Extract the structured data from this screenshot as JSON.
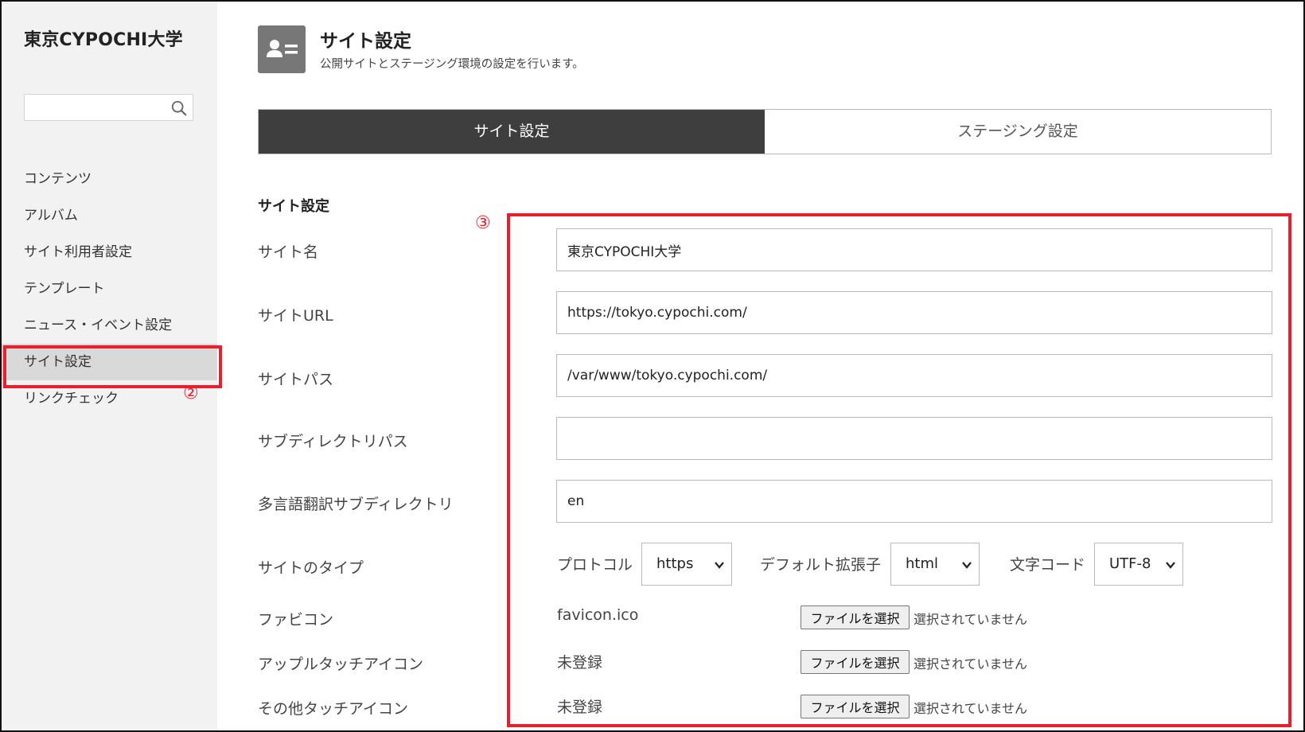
{
  "sidebar": {
    "brand": "東京CYPOCHI大学",
    "search": {
      "value": "",
      "placeholder": ""
    },
    "items": [
      {
        "label": "コンテンツ"
      },
      {
        "label": "アルバム"
      },
      {
        "label": "サイト利用者設定"
      },
      {
        "label": "テンプレート"
      },
      {
        "label": "ニュース・イベント設定"
      },
      {
        "label": "サイト設定",
        "active": true
      },
      {
        "label": "リンクチェック"
      }
    ]
  },
  "annotations": {
    "marker_2": "②",
    "marker_3": "③",
    "highlight_color": "#e8202e"
  },
  "header": {
    "title": "サイト設定",
    "subtitle": "公開サイトとステージング環境の設定を行います。"
  },
  "tabs": [
    {
      "label": "サイト設定",
      "active": true
    },
    {
      "label": "ステージング設定",
      "active": false
    }
  ],
  "form": {
    "section_title": "サイト設定",
    "site_name": {
      "label": "サイト名",
      "value": "東京CYPOCHI大学"
    },
    "site_url": {
      "label": "サイトURL",
      "value": "https://tokyo.cypochi.com/"
    },
    "site_path": {
      "label": "サイトパス",
      "value": "/var/www/tokyo.cypochi.com/"
    },
    "subdirectory_path": {
      "label": "サブディレクトリパス",
      "value": ""
    },
    "translation_subdirectory": {
      "label": "多言語翻訳サブディレクトリ",
      "value": "en"
    },
    "site_type": {
      "label": "サイトのタイプ",
      "protocol": {
        "label": "プロトコル",
        "value": "https"
      },
      "default_extension": {
        "label": "デフォルト拡張子",
        "value": "html"
      },
      "charset": {
        "label": "文字コード",
        "value": "UTF-8"
      }
    },
    "favicon": {
      "label": "ファビコン",
      "value": "favicon.ico",
      "button": "ファイルを選択",
      "status": "選択されていません"
    },
    "apple_touch_icon": {
      "label": "アップルタッチアイコン",
      "value": "未登録",
      "button": "ファイルを選択",
      "status": "選択されていません"
    },
    "other_touch_icon": {
      "label": "その他タッチアイコン",
      "value": "未登録",
      "button": "ファイルを選択",
      "status": "選択されていません"
    }
  },
  "colors": {
    "accent_red": "#e8202e",
    "tab_active_bg": "#3e3e3e",
    "sidebar_bg": "#f2f2f2",
    "active_nav_bg": "#d9d9d9"
  }
}
